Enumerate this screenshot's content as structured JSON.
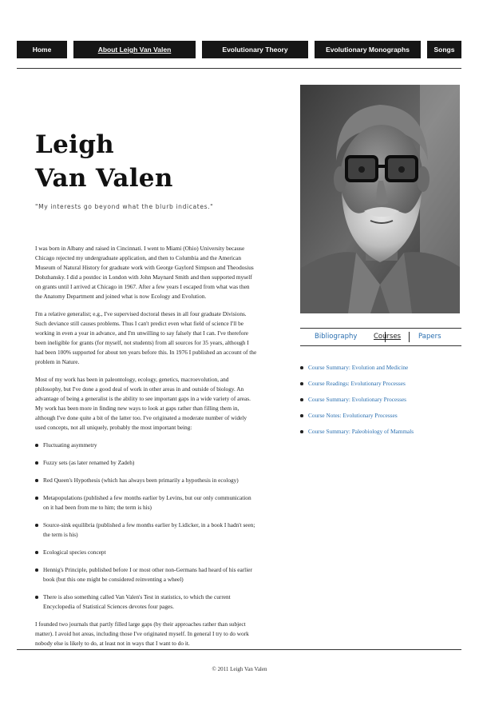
{
  "nav": {
    "items": [
      {
        "label": "Home"
      },
      {
        "label": "About Leigh Van Valen",
        "active": true
      },
      {
        "label": "Evolutionary Theory"
      },
      {
        "label": "Evolutionary Monographs"
      },
      {
        "label": "Songs"
      }
    ]
  },
  "hero": {
    "first_name": "Leigh",
    "last_name": "Van Valen",
    "tagline": "\"My interests go beyond what the blurb indicates.\""
  },
  "bio": {
    "paragraphs": [
      "I was born in Albany and raised in Cincinnati. I went to Miami (Ohio) University because Chicago rejected my undergraduate application, and then to Columbia and the American Museum of Natural History for graduate work with George Gaylord Simpson and Theodosius Dobzhansky. I did a postdoc in London with John Maynard Smith and then supported myself on grants until I arrived at Chicago in 1967. After a few years I escaped from what was then the Anatomy Department and joined what is now Ecology and Evolution.",
      "I'm a relative generalist; e.g., I've supervised doctoral theses in all four graduate Divisions. Such deviance still causes problems. Thus I can't predict even what field of science I'll be working in even a year in advance, and I'm unwilling to say falsely that I can. I've therefore been ineligible for grants (for myself, not students) from all sources for 35 years, although I had been 100% supported for about ten years before this. In 1976 I published an account of the problem in Nature.",
      "Most of my work has been in paleontology, ecology, genetics, macroevolution, and philosophy, but I've done a good deal of work in other areas in and outside of biology. An advantage of being a generalist is the ability to see important gaps in a wide variety of areas. My work has been more in finding new ways to look at gaps rather than filling them in, although I've done quite a bit of the latter too. I've originated a moderate number of widely used concepts, not all uniquely, probably the most important being:"
    ],
    "concepts": [
      "Fluctuating asymmetry",
      "Fuzzy sets (as later renamed by Zadeh)",
      "Red Queen's Hypothesis (which has always been primarily a hypothesis in ecology)",
      "Metapopulations (published a few months earlier by Levins, but our only communication on it had been from me to him; the term is his)",
      "Source-sink equilibria (published a few months earlier by Lidicker, in a book I hadn't seen; the term is his)",
      "Ecological species concept",
      "Hennig's Principle, published before I or most other non-Germans had heard of his earlier book (but this one might be considered reinventing a wheel)",
      "There is also something called Van Valen's Test in statistics, to which the current Encyclopedia of Statistical Sciences devotes four pages."
    ],
    "closing": "I founded two journals that partly filled large gaps (by their approaches rather than subject matter). I avoid hot areas, including those I've originated myself. In general I try to do work nobody else is likely to do, at least not in ways that I want to do it."
  },
  "tabs": {
    "items": [
      {
        "label": "Bibliography"
      },
      {
        "label": "Courses",
        "active": true
      },
      {
        "label": "Papers"
      }
    ]
  },
  "courses": [
    "Course Summary: Evolution and Medicine",
    "Course Readings: Evolutionary Processes",
    "Course Summary: Evolutionary Processes",
    "Course Notes: Evolutionary Processes",
    "Course Summary: Paleobiology of Mammals"
  ],
  "footer": {
    "copyright": "© 2011 Leigh Van Valen"
  },
  "colors": {
    "nav_bg": "#161616",
    "link": "#2a6fb0",
    "text": "#222222"
  }
}
